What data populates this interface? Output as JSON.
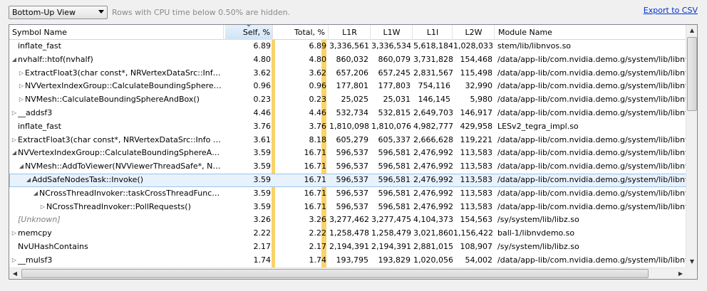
{
  "toolbar": {
    "view_select": "Bottom-Up View",
    "hint": "Rows with CPU time below 0.50% are hidden.",
    "export": "Export to CSV"
  },
  "columns": [
    "Symbol Name",
    "Self, %",
    "Total, %",
    "L1R",
    "L1W",
    "L1I",
    "L2W",
    "Module Name"
  ],
  "rows": [
    {
      "indent": 0,
      "expander": "none",
      "name": "inflate_fast",
      "self": "6.89",
      "total": "6.89",
      "l1r": "3,336,561",
      "l1w": "3,336,534",
      "l1i": "5,618,184",
      "l2w": "1,028,033",
      "module": "stem/lib/libnvos.so"
    },
    {
      "indent": 0,
      "expander": "expanded",
      "name": "nvhalf::htof(nvhalf)",
      "self": "4.80",
      "total": "4.80",
      "l1r": "860,032",
      "l1w": "860,079",
      "l1i": "3,731,828",
      "l2w": "154,468",
      "module": "/data/app-lib/com.nvidia.demo.g/system/lib/libnv"
    },
    {
      "indent": 1,
      "expander": "collapsed",
      "name": "ExtractFloat3(char const*, NRVertexDataSrc::Info co...",
      "self": "3.62",
      "total": "3.62",
      "l1r": "657,206",
      "l1w": "657,245",
      "l1i": "2,831,567",
      "l2w": "115,498",
      "module": "/data/app-lib/com.nvidia.demo.g/system/lib/libnv"
    },
    {
      "indent": 1,
      "expander": "collapsed",
      "name": "NVVertexIndexGroup::CalculateBoundingSphereA...",
      "self": "0.96",
      "total": "0.96",
      "l1r": "177,801",
      "l1w": "177,803",
      "l1i": "754,116",
      "l2w": "32,990",
      "module": "/data/app-lib/com.nvidia.demo.g/system/lib/libnv"
    },
    {
      "indent": 1,
      "expander": "collapsed",
      "name": "NVMesh::CalculateBoundingSphereAndBox()",
      "self": "0.23",
      "total": "0.23",
      "l1r": "25,025",
      "l1w": "25,031",
      "l1i": "146,145",
      "l2w": "5,980",
      "module": "/data/app-lib/com.nvidia.demo.g/system/lib/libnv"
    },
    {
      "indent": 0,
      "expander": "collapsed",
      "name": "__addsf3",
      "self": "4.46",
      "total": "4.46",
      "l1r": "532,734",
      "l1w": "532,815",
      "l1i": "2,649,703",
      "l2w": "146,917",
      "module": "/data/app-lib/com.nvidia.demo.g/system/lib/libnv"
    },
    {
      "indent": 0,
      "expander": "none",
      "name": "inflate_fast",
      "self": "3.76",
      "total": "3.76",
      "l1r": "1,810,098",
      "l1w": "1,810,076",
      "l1i": "4,982,777",
      "l2w": "429,958",
      "module": "LESv2_tegra_impl.so"
    },
    {
      "indent": 0,
      "expander": "collapsed",
      "name": "ExtractFloat3(char const*, NRVertexDataSrc::Info con...",
      "self": "3.61",
      "total": "8.18",
      "l1r": "605,279",
      "l1w": "605,337",
      "l1i": "2,666,628",
      "l2w": "119,221",
      "module": "/data/app-lib/com.nvidia.demo.g/system/lib/libnv"
    },
    {
      "indent": 0,
      "expander": "expanded",
      "name": "NVVertexIndexGroup::CalculateBoundingSphereAnd...",
      "self": "3.59",
      "total": "16.71",
      "l1r": "596,537",
      "l1w": "596,581",
      "l1i": "2,476,992",
      "l2w": "113,583",
      "module": "/data/app-lib/com.nvidia.demo.g/system/lib/libnv"
    },
    {
      "indent": 1,
      "expander": "expanded",
      "name": "NVMesh::AddToViewer(NVViewerThreadSafe*, NV...",
      "self": "3.59",
      "total": "16.71",
      "l1r": "596,537",
      "l1w": "596,581",
      "l1i": "2,476,992",
      "l2w": "113,583",
      "module": "/data/app-lib/com.nvidia.demo.g/system/lib/libnv"
    },
    {
      "indent": 2,
      "expander": "expanded",
      "name": "AddSafeNodesTask::Invoke()",
      "self": "3.59",
      "total": "16.71",
      "l1r": "596,537",
      "l1w": "596,581",
      "l1i": "2,476,992",
      "l2w": "113,583",
      "module": "/data/app-lib/com.nvidia.demo.g/system/lib/libnv",
      "selected": true
    },
    {
      "indent": 3,
      "expander": "expanded",
      "name": "NCrossThreadInvoker::taskCrossThreadFunc(v...",
      "self": "3.59",
      "total": "16.71",
      "l1r": "596,537",
      "l1w": "596,581",
      "l1i": "2,476,992",
      "l2w": "113,583",
      "module": "/data/app-lib/com.nvidia.demo.g/system/lib/libnv"
    },
    {
      "indent": 4,
      "expander": "collapsed",
      "name": "NCrossThreadInvoker::PollRequests()",
      "self": "3.59",
      "total": "16.71",
      "l1r": "596,537",
      "l1w": "596,581",
      "l1i": "2,476,992",
      "l2w": "113,583",
      "module": "/data/app-lib/com.nvidia.demo.g/system/lib/libnv"
    },
    {
      "indent": 0,
      "expander": "none",
      "name": "[Unknown]",
      "self": "3.26",
      "total": "3.26",
      "l1r": "3,277,462",
      "l1w": "3,277,475",
      "l1i": "4,104,373",
      "l2w": "154,563",
      "module": "/sy/system/lib/libz.so",
      "unknown": true
    },
    {
      "indent": 0,
      "expander": "collapsed",
      "name": "memcpy",
      "self": "2.22",
      "total": "2.22",
      "l1r": "1,258,478",
      "l1w": "1,258,479",
      "l1i": "3,021,860",
      "l2w": "1,156,422",
      "module": "ball-1/libnvdemo.so"
    },
    {
      "indent": 0,
      "expander": "none",
      "name": "NvUHashContains",
      "self": "2.17",
      "total": "2.17",
      "l1r": "2,194,391",
      "l1w": "2,194,391",
      "l1i": "2,881,015",
      "l2w": "108,907",
      "module": "/sy/system/lib/libz.so"
    },
    {
      "indent": 0,
      "expander": "collapsed",
      "name": "__mulsf3",
      "self": "1.74",
      "total": "1.74",
      "l1r": "193,795",
      "l1w": "193,829",
      "l1i": "1,020,056",
      "l2w": "54,002",
      "module": "/data/app-lib/com.nvidia.demo.g/system/lib/libnv"
    }
  ]
}
